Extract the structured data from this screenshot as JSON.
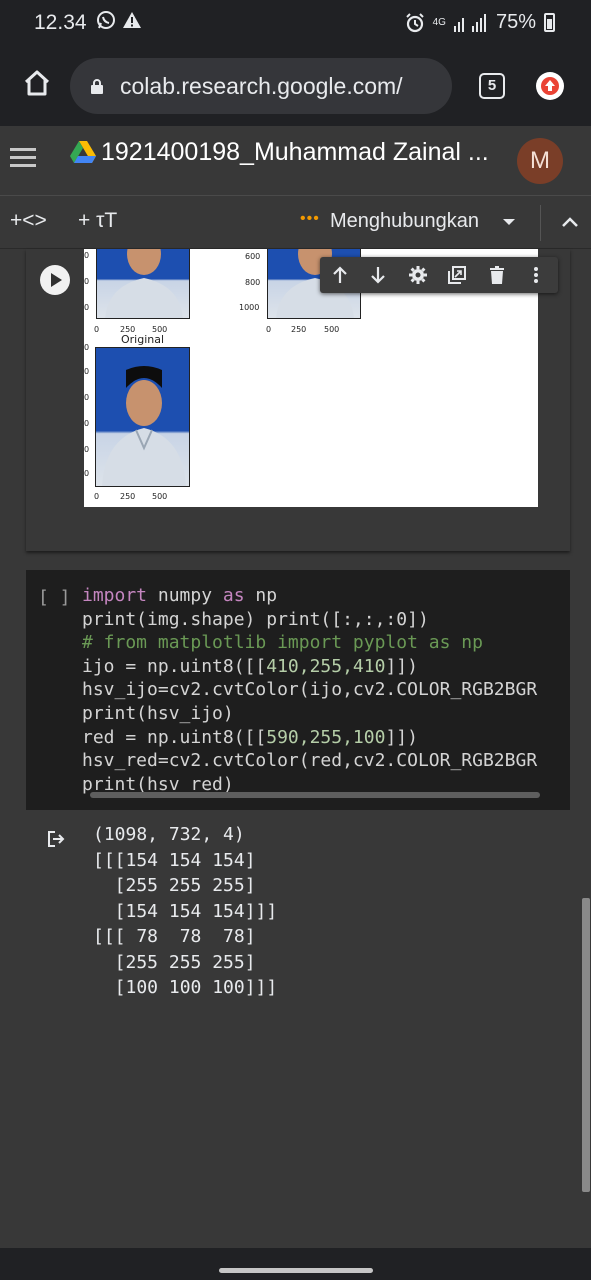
{
  "status_bar": {
    "time": "12.34",
    "notification_icons": [
      "whatsapp-icon",
      "warning-icon"
    ],
    "network": "4G",
    "battery": "75%"
  },
  "browser": {
    "url": "colab.research.google.com/",
    "tab_count": "5"
  },
  "notebook": {
    "title": "1921400198_Muhammad Zainal ...",
    "avatar_letter": "M",
    "insert_code_label": "+<>",
    "insert_text_label": "+ τT",
    "connection_status": "Menghubungkan",
    "connection_dots": "•••"
  },
  "figure": {
    "panels": [
      {
        "title": "",
        "y_ticks": [
          "0",
          "0",
          "0"
        ],
        "x_ticks": [
          "0",
          "250",
          "500"
        ]
      },
      {
        "title": "",
        "y_ticks": [
          "600",
          "800",
          "1000"
        ],
        "x_ticks": [
          "0",
          "250",
          "500"
        ]
      },
      {
        "title": "Original",
        "y_ticks": [
          "0",
          "0",
          "0",
          "0",
          "0",
          "0"
        ],
        "x_ticks": [
          "0",
          "250",
          "500"
        ]
      }
    ]
  },
  "code_cell": {
    "execution_count": "[ ]",
    "lines": [
      {
        "kw": "import",
        "rest": " numpy ",
        "kw2": "as",
        "rest2": " np"
      },
      {
        "text": "print(img.shape) print([:,:,:0])"
      },
      {
        "comment": "# from matplotlib import pyplot as np"
      },
      {
        "pre": "ijo = np.uint8([[",
        "nums": "410,255,410",
        "post": "]])"
      },
      {
        "text": "hsv_ijo=cv2.cvtColor(ijo,cv2.COLOR_RGB2BGR"
      },
      {
        "text": "print(hsv_ijo)"
      },
      {
        "pre": "red = np.uint8([[",
        "nums": "590,255,100",
        "post": "]])"
      },
      {
        "text": "hsv_red=cv2.cvtColor(red,cv2.COLOR_RGB2BGR"
      },
      {
        "text": "print(hsv_red)"
      }
    ]
  },
  "output": {
    "lines": [
      "(1098, 732, 4)",
      "[[[154 154 154]",
      "  [255 255 255]",
      "  [154 154 154]]]",
      "[[[ 78  78  78]",
      "  [255 255 255]",
      "  [100 100 100]]]"
    ]
  },
  "colors": {
    "accent_orange": "#f29900",
    "avatar_bg": "#7a3e28",
    "code_bg": "#1e1e1e",
    "keyword": "#c586c0",
    "comment": "#6a9955"
  }
}
